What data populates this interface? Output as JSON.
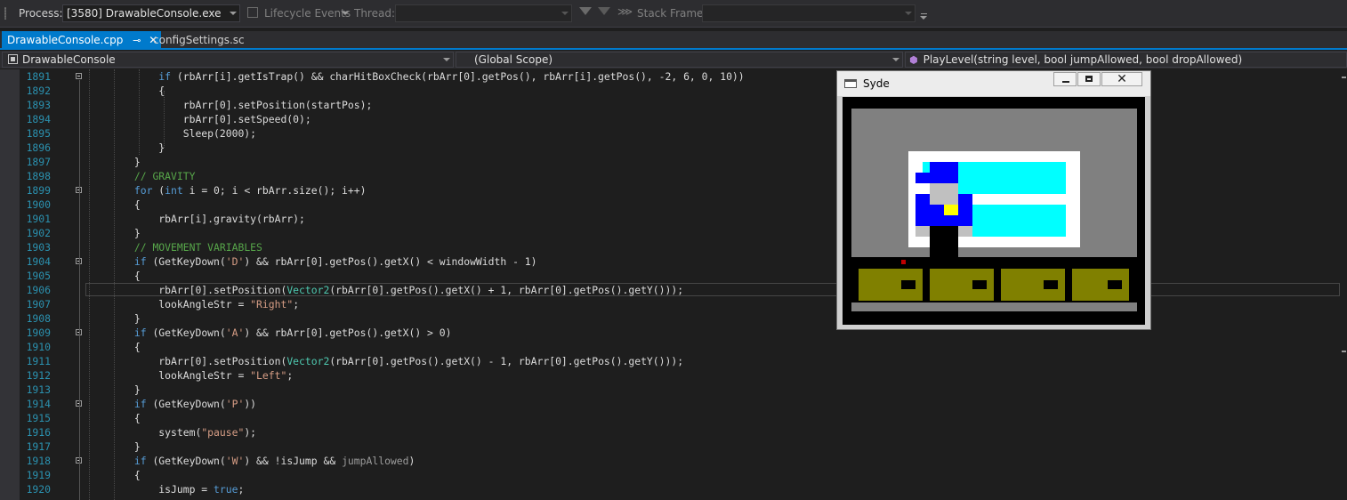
{
  "toolbar": {
    "process_label": "Process:",
    "process_value": "[3580] DrawableConsole.exe",
    "lifecycle_label": "Lifecycle Events",
    "thread_label": "Thread:",
    "thread_value": "",
    "stack_frame_label": "Stack Frame:",
    "stack_frame_value": ""
  },
  "tabs": [
    {
      "label": "DrawableConsole.cpp",
      "pin_icon": "pin-icon",
      "close_icon": "close-icon",
      "active": true
    },
    {
      "label": "configSettings.sc",
      "active": false
    }
  ],
  "navbar": {
    "project": "DrawableConsole",
    "scope": "(Global Scope)",
    "member": "PlayLevel(string level, bool jumpAllowed, bool dropAllowed)"
  },
  "editor": {
    "current_line": 1906,
    "lines": [
      {
        "n": "1891",
        "fold": true,
        "tokens": [
          {
            "t": "            "
          },
          {
            "t": "if",
            "c": "kw"
          },
          {
            "t": " (rbArr[i].getIsTrap() && charHitBoxCheck(rbArr[0].getPos(), rbArr[i].getPos(), -2, 6, 0, 10))"
          }
        ]
      },
      {
        "n": "1892",
        "tokens": [
          {
            "t": "            {"
          }
        ]
      },
      {
        "n": "1893",
        "tokens": [
          {
            "t": "                rbArr[0].setPosition(startPos);"
          }
        ]
      },
      {
        "n": "1894",
        "tokens": [
          {
            "t": "                rbArr[0].setSpeed(0);"
          }
        ]
      },
      {
        "n": "1895",
        "tokens": [
          {
            "t": "                Sleep(2000);"
          }
        ]
      },
      {
        "n": "1896",
        "tokens": [
          {
            "t": "            }"
          }
        ]
      },
      {
        "n": "1897",
        "tokens": [
          {
            "t": "        }"
          }
        ]
      },
      {
        "n": "1898",
        "tokens": [
          {
            "t": "        "
          },
          {
            "t": "// GRAVITY",
            "c": "cm"
          }
        ]
      },
      {
        "n": "1899",
        "fold": true,
        "tokens": [
          {
            "t": "        "
          },
          {
            "t": "for",
            "c": "kw"
          },
          {
            "t": " ("
          },
          {
            "t": "int",
            "c": "kw"
          },
          {
            "t": " i = 0; i < rbArr.size(); i++)"
          }
        ]
      },
      {
        "n": "1900",
        "tokens": [
          {
            "t": "        {"
          }
        ]
      },
      {
        "n": "1901",
        "tokens": [
          {
            "t": "            rbArr[i].gravity(rbArr);"
          }
        ]
      },
      {
        "n": "1902",
        "tokens": [
          {
            "t": "        }"
          }
        ]
      },
      {
        "n": "1903",
        "tokens": [
          {
            "t": "        "
          },
          {
            "t": "// MOVEMENT VARIABLES",
            "c": "cm"
          }
        ]
      },
      {
        "n": "1904",
        "fold": true,
        "tokens": [
          {
            "t": "        "
          },
          {
            "t": "if",
            "c": "kw"
          },
          {
            "t": " (GetKeyDown("
          },
          {
            "t": "'D'",
            "c": "st"
          },
          {
            "t": ") && rbArr[0].getPos().getX() < windowWidth - 1)"
          }
        ]
      },
      {
        "n": "1905",
        "tokens": [
          {
            "t": "        {"
          }
        ]
      },
      {
        "n": "1906",
        "tokens": [
          {
            "t": "            rbArr[0].setPosition("
          },
          {
            "t": "Vector2",
            "c": "ty"
          },
          {
            "t": "(rbArr[0].getPos().getX() + 1, rbArr[0].getPos().getY()));"
          }
        ]
      },
      {
        "n": "1907",
        "tokens": [
          {
            "t": "            lookAngleStr = "
          },
          {
            "t": "\"Right\"",
            "c": "st"
          },
          {
            "t": ";"
          }
        ]
      },
      {
        "n": "1908",
        "tokens": [
          {
            "t": "        }"
          }
        ]
      },
      {
        "n": "1909",
        "fold": true,
        "tokens": [
          {
            "t": "        "
          },
          {
            "t": "if",
            "c": "kw"
          },
          {
            "t": " (GetKeyDown("
          },
          {
            "t": "'A'",
            "c": "st"
          },
          {
            "t": ") && rbArr[0].getPos().getX() > 0)"
          }
        ]
      },
      {
        "n": "1910",
        "tokens": [
          {
            "t": "        {"
          }
        ]
      },
      {
        "n": "1911",
        "tokens": [
          {
            "t": "            rbArr[0].setPosition("
          },
          {
            "t": "Vector2",
            "c": "ty"
          },
          {
            "t": "(rbArr[0].getPos().getX() - 1, rbArr[0].getPos().getY()));"
          }
        ]
      },
      {
        "n": "1912",
        "tokens": [
          {
            "t": "            lookAngleStr = "
          },
          {
            "t": "\"Left\"",
            "c": "st"
          },
          {
            "t": ";"
          }
        ]
      },
      {
        "n": "1913",
        "tokens": [
          {
            "t": "        }"
          }
        ]
      },
      {
        "n": "1914",
        "fold": true,
        "tokens": [
          {
            "t": "        "
          },
          {
            "t": "if",
            "c": "kw"
          },
          {
            "t": " (GetKeyDown("
          },
          {
            "t": "'P'",
            "c": "st"
          },
          {
            "t": "))"
          }
        ]
      },
      {
        "n": "1915",
        "tokens": [
          {
            "t": "        {"
          }
        ]
      },
      {
        "n": "1916",
        "tokens": [
          {
            "t": "            system("
          },
          {
            "t": "\"pause\"",
            "c": "st"
          },
          {
            "t": ");"
          }
        ]
      },
      {
        "n": "1917",
        "tokens": [
          {
            "t": "        }"
          }
        ]
      },
      {
        "n": "1918",
        "fold": true,
        "tokens": [
          {
            "t": "        "
          },
          {
            "t": "if",
            "c": "kw"
          },
          {
            "t": " (GetKeyDown("
          },
          {
            "t": "'W'",
            "c": "st"
          },
          {
            "t": ") && !isJump && "
          },
          {
            "t": "jumpAllowed",
            "c": "gr"
          },
          {
            "t": ")"
          }
        ]
      },
      {
        "n": "1919",
        "tokens": [
          {
            "t": "        {"
          }
        ]
      },
      {
        "n": "1920",
        "tokens": [
          {
            "t": "            isJump = "
          },
          {
            "t": "true",
            "c": "kw"
          },
          {
            "t": ";"
          }
        ]
      }
    ]
  },
  "console_window": {
    "title": "Syde",
    "icon": "console-window-icon",
    "close_glyph": "✕"
  },
  "colors": {
    "accent": "#007acc",
    "keyword": "#569cd6",
    "comment": "#57a64a",
    "string": "#d69d85",
    "type": "#4ec9b0",
    "line_number": "#2b91af",
    "game_sky": "#808080",
    "game_cyan": "#00ffff",
    "game_blue": "#0000ff",
    "game_olive": "#808000",
    "game_yellow": "#ffff00"
  }
}
